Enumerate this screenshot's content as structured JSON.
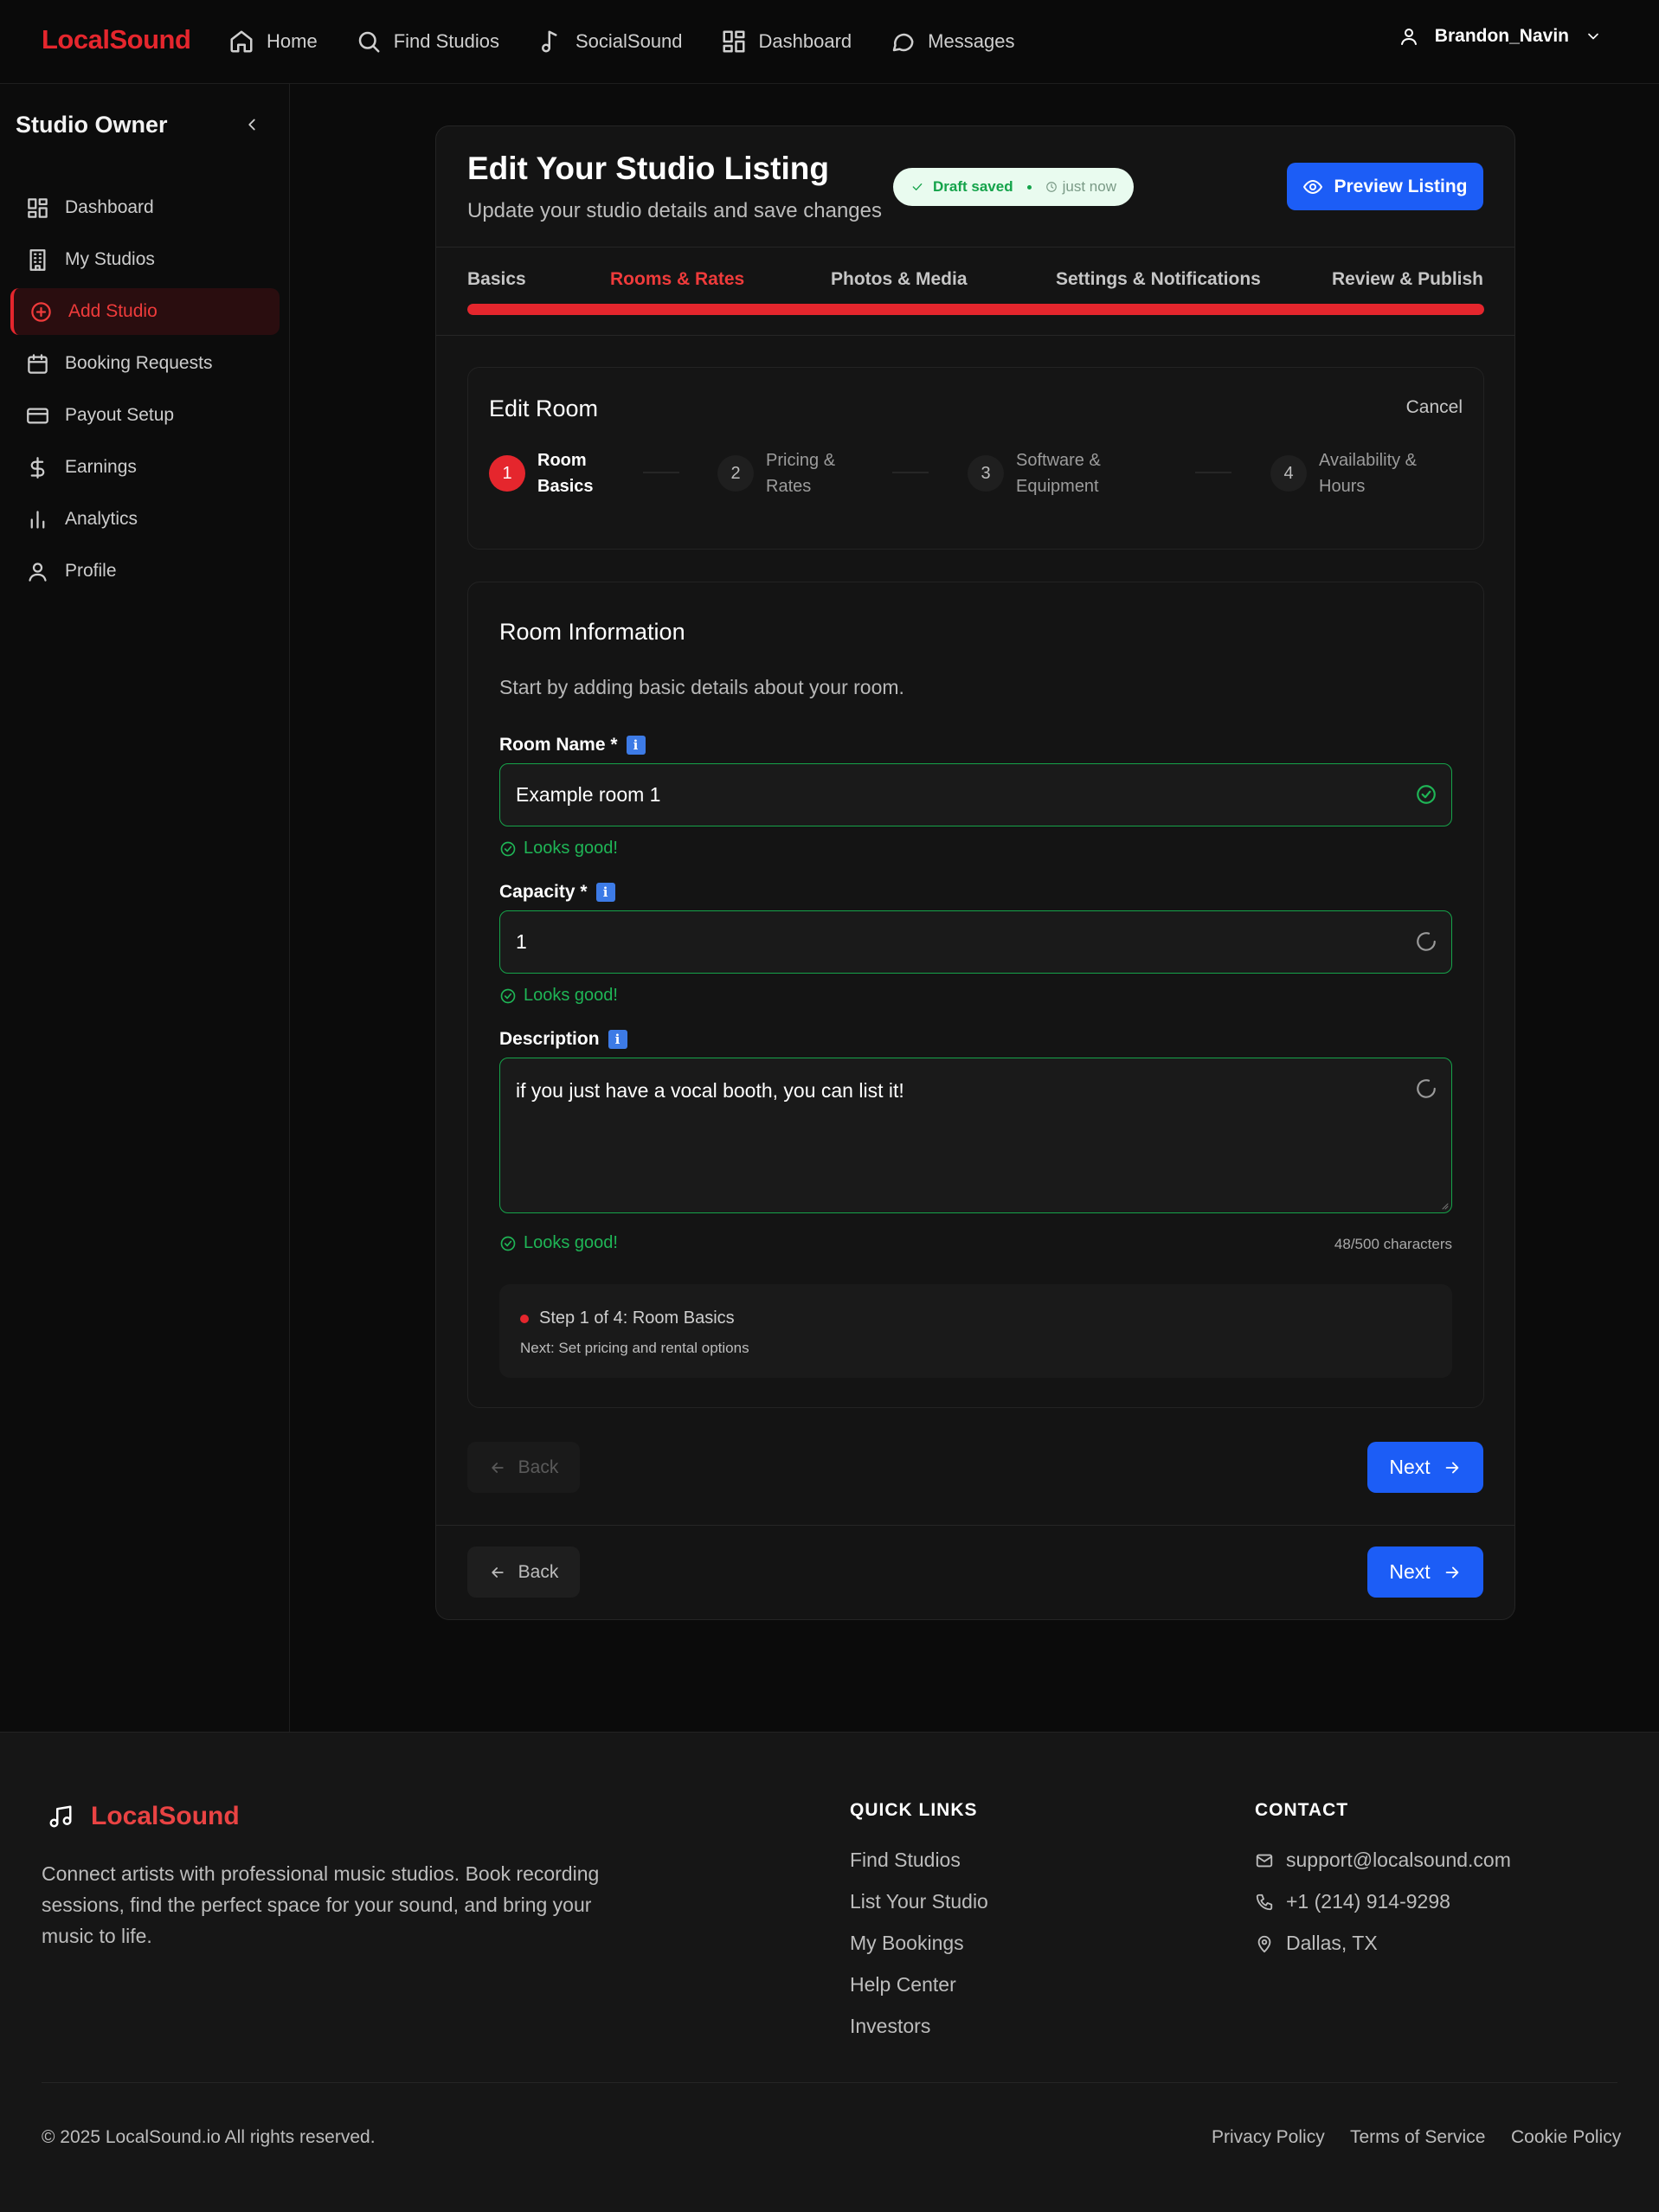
{
  "brand": "LocalSound",
  "nav": {
    "items": [
      {
        "label": "Home",
        "icon": "home-icon"
      },
      {
        "label": "Find Studios",
        "icon": "search-icon"
      },
      {
        "label": "SocialSound",
        "icon": "music-note-icon"
      },
      {
        "label": "Dashboard",
        "icon": "dashboard-icon"
      },
      {
        "label": "Messages",
        "icon": "message-icon"
      }
    ],
    "user": "Brandon_Navin"
  },
  "sidebar": {
    "title": "Studio Owner",
    "items": [
      {
        "label": "Dashboard",
        "icon": "dashboard-icon"
      },
      {
        "label": "My Studios",
        "icon": "building-icon"
      },
      {
        "label": "Add Studio",
        "icon": "plus-circle-icon",
        "active": true
      },
      {
        "label": "Booking Requests",
        "icon": "calendar-icon"
      },
      {
        "label": "Payout Setup",
        "icon": "credit-card-icon"
      },
      {
        "label": "Earnings",
        "icon": "dollar-icon"
      },
      {
        "label": "Analytics",
        "icon": "bar-chart-icon"
      },
      {
        "label": "Profile",
        "icon": "user-icon"
      }
    ]
  },
  "header": {
    "title": "Edit Your Studio Listing",
    "subtitle": "Update your studio details and save changes",
    "draft_status": "Draft saved",
    "draft_time": "just now",
    "preview_label": "Preview Listing"
  },
  "tabs": [
    "Basics",
    "Rooms & Rates",
    "Photos & Media",
    "Settings & Notifications",
    "Review & Publish"
  ],
  "active_tab": 1,
  "tab_progress_percent": 100,
  "edit_room": {
    "title": "Edit Room",
    "cancel": "Cancel",
    "steps": [
      {
        "num": "1",
        "label": "Room Basics"
      },
      {
        "num": "2",
        "label": "Pricing & Rates"
      },
      {
        "num": "3",
        "label": "Software & Equipment"
      },
      {
        "num": "4",
        "label": "Availability & Hours"
      }
    ]
  },
  "form": {
    "title": "Room Information",
    "subtitle": "Start by adding basic details about your room.",
    "room_name_label": "Room Name *",
    "room_name_value": "Example room 1",
    "capacity_label": "Capacity *",
    "capacity_value": "1",
    "description_label": "Description",
    "description_value": "if you just have a vocal booth, you can list it!",
    "valid_msg": "Looks good!",
    "char_count": "48/500 characters",
    "step_info": "Step 1 of 4: Room Basics",
    "step_next": "Next: Set pricing and rental options",
    "info_glyph": "i"
  },
  "buttons": {
    "back": "Back",
    "next": "Next"
  },
  "footer": {
    "brand": "LocalSound",
    "description": "Connect artists with professional music studios. Book recording sessions, find the perfect space for your sound, and bring your music to life.",
    "quick_links_heading": "QUICK LINKS",
    "quick_links": [
      "Find Studios",
      "List Your Studio",
      "My Bookings",
      "Help Center",
      "Investors"
    ],
    "contact_heading": "CONTACT",
    "email": "support@localsound.com",
    "phone": "+1 (214) 914-9298",
    "location": "Dallas, TX",
    "copyright": "© 2025 LocalSound.io All rights reserved.",
    "legal": [
      "Privacy Policy",
      "Terms of Service",
      "Cookie Policy"
    ]
  },
  "colors": {
    "accent_red": "#e5262d",
    "primary_blue": "#1c5df6",
    "success_green": "#16a34a"
  }
}
